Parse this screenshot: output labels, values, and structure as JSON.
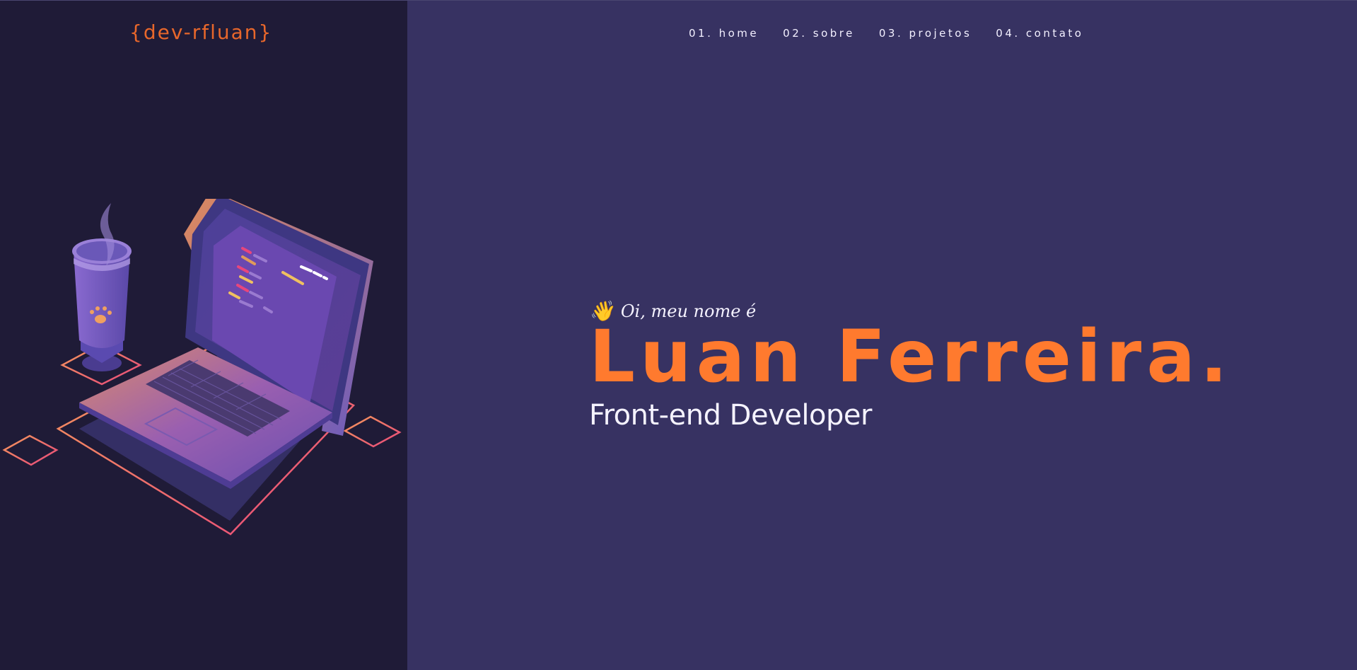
{
  "brand": {
    "logo_text": "{dev-rfluan}"
  },
  "nav": {
    "items": [
      {
        "label": "01. home"
      },
      {
        "label": "02. sobre"
      },
      {
        "label": "03. projetos"
      },
      {
        "label": "04. contato"
      }
    ]
  },
  "hero": {
    "wave_emoji": "👋",
    "greeting": "Oi, meu nome é",
    "name": "Luan Ferreira.",
    "role": "Front-end Developer"
  },
  "colors": {
    "left_panel_bg": "#1f1b37",
    "right_panel_bg": "#373262",
    "accent_orange": "#ff7a2e",
    "logo_orange": "#e8672b",
    "text_light": "#f5f3ff"
  },
  "illustration": {
    "icon_names": [
      "laptop-icon",
      "coffee-cup-icon",
      "steam-icon",
      "paw-icon",
      "diamond-outline-icon"
    ]
  }
}
